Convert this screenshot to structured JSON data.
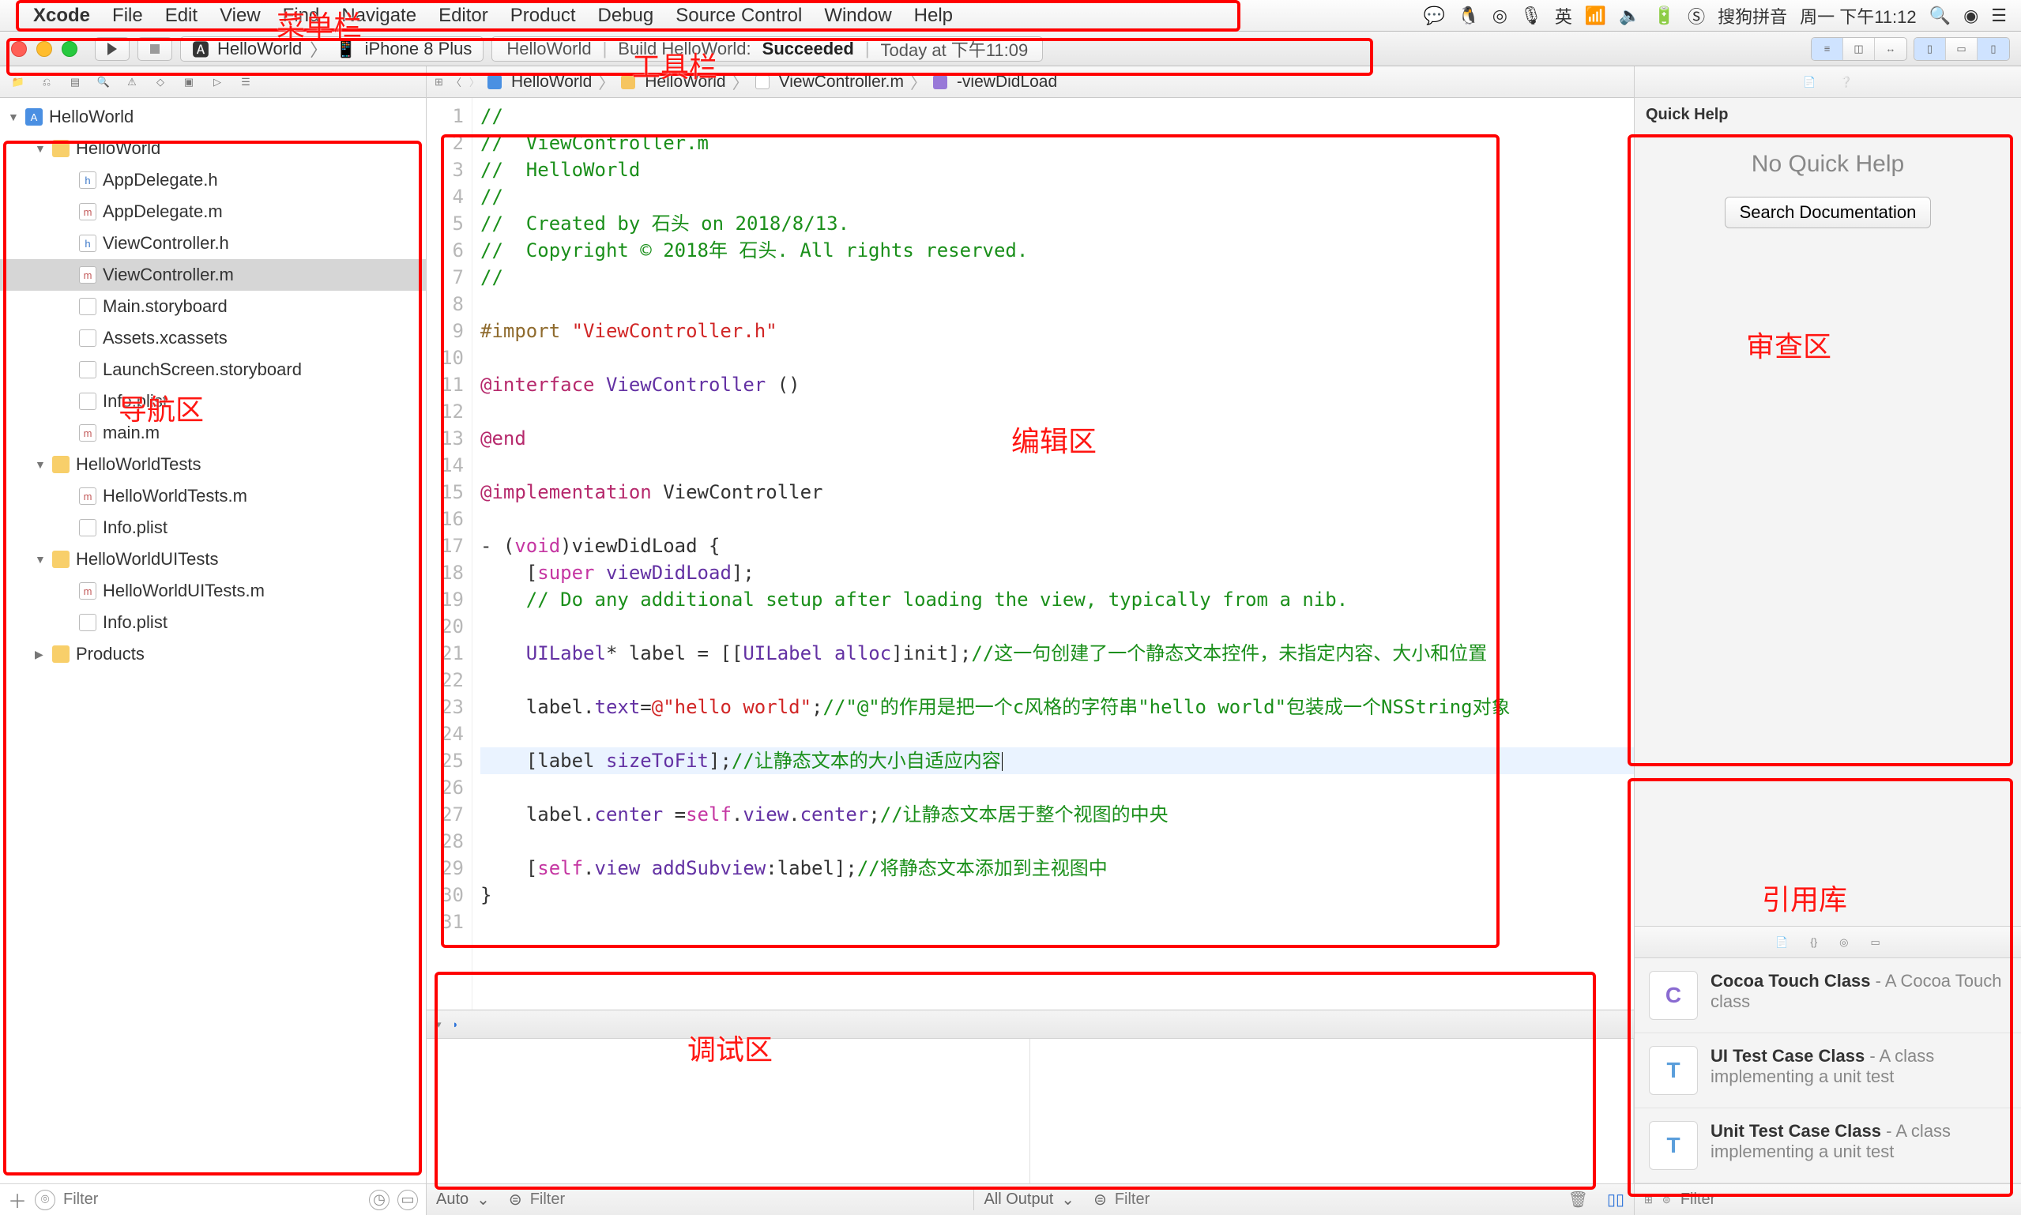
{
  "menubar": {
    "apple": "",
    "items": [
      "Xcode",
      "File",
      "Edit",
      "View",
      "Find",
      "Navigate",
      "Editor",
      "Product",
      "Debug",
      "Source Control",
      "Window",
      "Help"
    ]
  },
  "status": {
    "ime": "搜狗拼音",
    "clock": "周一 下午11:12",
    "ime_label": "英"
  },
  "toolbar": {
    "scheme_app": "HelloWorld",
    "scheme_device": "iPhone 8 Plus",
    "status_prefix": "HelloWorld",
    "status_text": "Build HelloWorld:",
    "status_result": "Succeeded",
    "status_time": "Today at 下午11:09"
  },
  "jumpbar": {
    "crumbs": [
      "HelloWorld",
      "HelloWorld",
      "ViewController.m",
      "-viewDidLoad"
    ]
  },
  "navigator": {
    "tree": [
      {
        "depth": 0,
        "icon": "proj",
        "label": "HelloWorld",
        "disclose": "down"
      },
      {
        "depth": 1,
        "icon": "folder",
        "label": "HelloWorld",
        "disclose": "down"
      },
      {
        "depth": 2,
        "icon": "h",
        "label": "AppDelegate.h"
      },
      {
        "depth": 2,
        "icon": "m",
        "label": "AppDelegate.m"
      },
      {
        "depth": 2,
        "icon": "h",
        "label": "ViewController.h"
      },
      {
        "depth": 2,
        "icon": "m",
        "label": "ViewController.m",
        "selected": true
      },
      {
        "depth": 2,
        "icon": "sb",
        "label": "Main.storyboard"
      },
      {
        "depth": 2,
        "icon": "xc",
        "label": "Assets.xcassets"
      },
      {
        "depth": 2,
        "icon": "sb",
        "label": "LaunchScreen.storyboard"
      },
      {
        "depth": 2,
        "icon": "plist",
        "label": "Info.plist"
      },
      {
        "depth": 2,
        "icon": "m",
        "label": "main.m"
      },
      {
        "depth": 1,
        "icon": "folder",
        "label": "HelloWorldTests",
        "disclose": "down"
      },
      {
        "depth": 2,
        "icon": "m",
        "label": "HelloWorldTests.m"
      },
      {
        "depth": 2,
        "icon": "plist",
        "label": "Info.plist"
      },
      {
        "depth": 1,
        "icon": "folder",
        "label": "HelloWorldUITests",
        "disclose": "down"
      },
      {
        "depth": 2,
        "icon": "m",
        "label": "HelloWorldUITests.m"
      },
      {
        "depth": 2,
        "icon": "plist",
        "label": "Info.plist"
      },
      {
        "depth": 1,
        "icon": "folder",
        "label": "Products",
        "disclose": "right"
      }
    ],
    "filter_placeholder": "Filter"
  },
  "code": {
    "lines": [
      {
        "n": 1,
        "seg": [
          {
            "t": "//",
            "c": "comment"
          }
        ]
      },
      {
        "n": 2,
        "seg": [
          {
            "t": "//  ViewController.m",
            "c": "comment"
          }
        ]
      },
      {
        "n": 3,
        "seg": [
          {
            "t": "//  HelloWorld",
            "c": "comment"
          }
        ]
      },
      {
        "n": 4,
        "seg": [
          {
            "t": "//",
            "c": "comment"
          }
        ]
      },
      {
        "n": 5,
        "seg": [
          {
            "t": "//  Created by 石头 on 2018/8/13.",
            "c": "comment"
          }
        ]
      },
      {
        "n": 6,
        "seg": [
          {
            "t": "//  Copyright © 2018年 石头. All rights reserved.",
            "c": "comment"
          }
        ]
      },
      {
        "n": 7,
        "seg": [
          {
            "t": "//",
            "c": "comment"
          }
        ]
      },
      {
        "n": 8,
        "seg": [
          {
            "t": ""
          }
        ]
      },
      {
        "n": 9,
        "seg": [
          {
            "t": "#import ",
            "c": "pre"
          },
          {
            "t": "\"ViewController.h\"",
            "c": "str"
          }
        ]
      },
      {
        "n": 10,
        "seg": [
          {
            "t": ""
          }
        ]
      },
      {
        "n": 11,
        "seg": [
          {
            "t": "@interface",
            "c": "objc"
          },
          {
            "t": " "
          },
          {
            "t": "ViewController",
            "c": "type"
          },
          {
            "t": " ()"
          }
        ]
      },
      {
        "n": 12,
        "seg": [
          {
            "t": ""
          }
        ]
      },
      {
        "n": 13,
        "seg": [
          {
            "t": "@end",
            "c": "objc"
          }
        ]
      },
      {
        "n": 14,
        "seg": [
          {
            "t": ""
          }
        ]
      },
      {
        "n": 15,
        "seg": [
          {
            "t": "@implementation",
            "c": "objc"
          },
          {
            "t": " "
          },
          {
            "t": "ViewController"
          }
        ]
      },
      {
        "n": 16,
        "seg": [
          {
            "t": ""
          }
        ]
      },
      {
        "n": 17,
        "seg": [
          {
            "t": "- ("
          },
          {
            "t": "void",
            "c": "kw"
          },
          {
            "t": ")viewDidLoad {"
          }
        ]
      },
      {
        "n": 18,
        "seg": [
          {
            "t": "    ["
          },
          {
            "t": "super",
            "c": "kw"
          },
          {
            "t": " "
          },
          {
            "t": "viewDidLoad",
            "c": "type"
          },
          {
            "t": "];"
          }
        ]
      },
      {
        "n": 19,
        "seg": [
          {
            "t": "    "
          },
          {
            "t": "// Do any additional setup after loading the view, typically from a nib.",
            "c": "comment"
          }
        ]
      },
      {
        "n": 20,
        "seg": [
          {
            "t": ""
          }
        ]
      },
      {
        "n": 21,
        "seg": [
          {
            "t": "    "
          },
          {
            "t": "UILabel",
            "c": "type"
          },
          {
            "t": "* label = [["
          },
          {
            "t": "UILabel",
            "c": "type"
          },
          {
            "t": " "
          },
          {
            "t": "alloc",
            "c": "type"
          },
          {
            "t": "]init];"
          },
          {
            "t": "//这一句创建了一个静态文本控件，未指定内容、大小和位置",
            "c": "comment"
          }
        ]
      },
      {
        "n": 22,
        "seg": [
          {
            "t": ""
          }
        ]
      },
      {
        "n": 23,
        "seg": [
          {
            "t": "    label."
          },
          {
            "t": "text",
            "c": "type"
          },
          {
            "t": "="
          },
          {
            "t": "@\"hello world\"",
            "c": "str"
          },
          {
            "t": ";"
          },
          {
            "t": "//\"@\"的作用是把一个c风格的字符串\"hello world\"包装成一个NSString对象",
            "c": "comment"
          }
        ]
      },
      {
        "n": 24,
        "seg": [
          {
            "t": ""
          }
        ]
      },
      {
        "n": 25,
        "hl": true,
        "seg": [
          {
            "t": "    [label "
          },
          {
            "t": "sizeToFit",
            "c": "type"
          },
          {
            "t": "];"
          },
          {
            "t": "//让静态文本的大小自适应内容",
            "c": "comment"
          }
        ],
        "caret": true
      },
      {
        "n": 26,
        "seg": [
          {
            "t": ""
          }
        ]
      },
      {
        "n": 27,
        "seg": [
          {
            "t": "    label."
          },
          {
            "t": "center",
            "c": "type"
          },
          {
            "t": " ="
          },
          {
            "t": "self",
            "c": "kw"
          },
          {
            "t": "."
          },
          {
            "t": "view",
            "c": "type"
          },
          {
            "t": "."
          },
          {
            "t": "center",
            "c": "type"
          },
          {
            "t": ";"
          },
          {
            "t": "//让静态文本居于整个视图的中央",
            "c": "comment"
          }
        ]
      },
      {
        "n": 28,
        "seg": [
          {
            "t": ""
          }
        ]
      },
      {
        "n": 29,
        "seg": [
          {
            "t": "    ["
          },
          {
            "t": "self",
            "c": "kw"
          },
          {
            "t": "."
          },
          {
            "t": "view",
            "c": "type"
          },
          {
            "t": " "
          },
          {
            "t": "addSubview",
            "c": "type"
          },
          {
            "t": ":label];"
          },
          {
            "t": "//将静态文本添加到主视图中",
            "c": "comment"
          }
        ]
      },
      {
        "n": 30,
        "seg": [
          {
            "t": "}"
          }
        ]
      },
      {
        "n": 31,
        "seg": [
          {
            "t": ""
          }
        ]
      }
    ]
  },
  "debug": {
    "auto": "Auto",
    "filter1": "Filter",
    "output": "All Output",
    "filter2": "Filter"
  },
  "inspector": {
    "qh_title": "Quick Help",
    "qh_msg": "No Quick Help",
    "qh_btn": "Search Documentation"
  },
  "library": {
    "items": [
      {
        "thumb": "C",
        "name": "Cocoa Touch Class",
        "sub": " - A Cocoa Touch class"
      },
      {
        "thumb": "T",
        "name": "UI Test Case Class",
        "sub": " - A class implementing a unit test"
      },
      {
        "thumb": "T",
        "name": "Unit Test Case Class",
        "sub": " - A class implementing a unit test"
      }
    ],
    "filter_placeholder": "Filter"
  },
  "annotations": {
    "menubar": "菜单栏",
    "toolbar": "工具栏",
    "navigator": "导航区",
    "editor": "编辑区",
    "debug": "调试区",
    "inspector": "审查区",
    "library": "引用库"
  }
}
